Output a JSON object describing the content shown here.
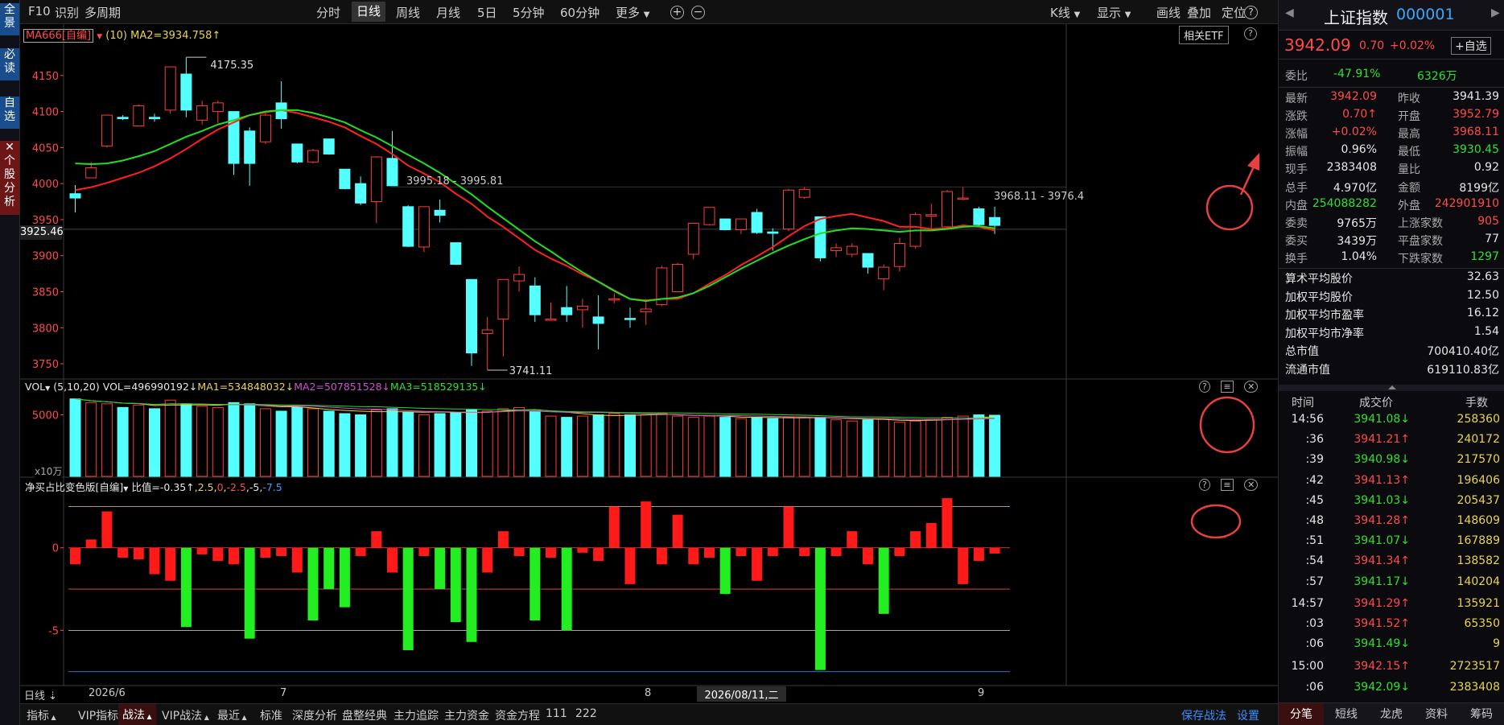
{
  "left_strip": [
    {
      "name": "quanjing",
      "label": "全\n景"
    },
    {
      "name": "bidu",
      "label": "必\n读"
    },
    {
      "name": "zixuan",
      "label": "自\n选"
    },
    {
      "name": "gegu-fenxi",
      "label": "✕\n个\n股\n分\n析"
    }
  ],
  "topbar": {
    "left": [
      "F10",
      "识别",
      "多周期"
    ],
    "periods": [
      "分时",
      "日线",
      "周线",
      "月线",
      "5日",
      "5分钟",
      "60分钟",
      "更多"
    ],
    "active_period": "日线",
    "right": [
      "K线",
      "显示",
      "画线",
      "叠加",
      "定位"
    ]
  },
  "main_chart": {
    "ma_label": "MA666[自编]",
    "ma_param": "(10)",
    "ma2": "MA2=3934.758↑",
    "etf_button": "相关ETF",
    "y_ticks": [
      "4150",
      "4100",
      "4050",
      "4000",
      "3950",
      "3900",
      "3850",
      "3800",
      "3750"
    ],
    "cursor_price": "3925.46",
    "high_label": "4175.35",
    "low_label": "3741.11",
    "range_label_1": "3995.18 - 3995.81",
    "range_label_2": "3968.11 - 3976.4"
  },
  "vol_panel": {
    "title": "VOL",
    "params": "(5,10,20)",
    "vol": "VOL=496990192↓",
    "ma1": "MA1=534848032↓",
    "ma2": "MA2=507851528↓",
    "ma3": "MA3=518529135↓",
    "y_tick": "5000",
    "unit": "x10万"
  },
  "ratio_panel": {
    "title": "净买占比变色版[自编]",
    "desc": "比值=-0.35↑",
    "values": [
      "2.5",
      "0",
      "-2.5",
      "-5",
      "-7.5"
    ],
    "y_ticks": [
      "0",
      "-5"
    ]
  },
  "date_axis": {
    "period": "日线",
    "labels": [
      "2026/6",
      "7",
      "8",
      "9"
    ],
    "cursor_date": "2026/08/11,二"
  },
  "bottombar": {
    "tabs": [
      "指标",
      "VIP指标",
      "战法",
      "VIP战法",
      "最近"
    ],
    "items": [
      "标准",
      "深度分析",
      "盘整经典",
      "主力追踪",
      "主力资金",
      "资金方程",
      "111",
      "222"
    ],
    "save": "保存战法",
    "settings": "设置"
  },
  "quote": {
    "name": "上证指数",
    "code": "000001",
    "price": "3942.09",
    "change": "0.70",
    "change_pct": "+0.02%",
    "add_watch": "+自选",
    "weibi_label": "委比",
    "weibi": "-47.91%",
    "weicha": "6326万",
    "rows": [
      {
        "l1": "最新",
        "v1": "3942.09",
        "c1": "red",
        "l2": "昨收",
        "v2": "3941.39",
        "c2": "white"
      },
      {
        "l1": "涨跌",
        "v1": "0.70↑",
        "c1": "red",
        "l2": "开盘",
        "v2": "3952.79",
        "c2": "red"
      },
      {
        "l1": "涨幅",
        "v1": "+0.02%",
        "c1": "red",
        "l2": "最高",
        "v2": "3968.11",
        "c2": "red"
      },
      {
        "l1": "振幅",
        "v1": "0.96%",
        "c1": "white",
        "l2": "最低",
        "v2": "3930.45",
        "c2": "green"
      },
      {
        "l1": "现手",
        "v1": "2383408",
        "c1": "white",
        "l2": "量比",
        "v2": "0.92",
        "c2": "white"
      },
      {
        "l1": "总手",
        "v1": "4.970亿",
        "c1": "white",
        "l2": "金额",
        "v2": "8199亿",
        "c2": "white"
      },
      {
        "l1": "内盘",
        "v1": "254088282",
        "c1": "green",
        "l2": "外盘",
        "v2": "242901910",
        "c2": "red"
      },
      {
        "l1": "委卖",
        "v1": "9765万",
        "c1": "white",
        "l2": "上涨家数",
        "v2": "905",
        "c2": "red"
      },
      {
        "l1": "委买",
        "v1": "3439万",
        "c1": "white",
        "l2": "平盘家数",
        "v2": "77",
        "c2": "white"
      },
      {
        "l1": "换手",
        "v1": "1.04%",
        "c1": "white",
        "l2": "下跌家数",
        "v2": "1297",
        "c2": "green"
      }
    ],
    "stats": [
      {
        "label": "算术平均股价",
        "value": "32.63"
      },
      {
        "label": "加权平均股价",
        "value": "12.50"
      },
      {
        "label": "加权平均市盈率",
        "value": "16.12"
      },
      {
        "label": "加权平均市净率",
        "value": "1.54"
      },
      {
        "label": "总市值",
        "value": "700410.40亿"
      },
      {
        "label": "流通市值",
        "value": "619110.83亿"
      }
    ]
  },
  "ticks_header": {
    "time": "时间",
    "price": "成交价",
    "vol": "手数"
  },
  "ticks": [
    {
      "time": "14:56",
      "price": "3941.08↓",
      "dir": "green",
      "vol": "258360"
    },
    {
      "time": ":36",
      "price": "3941.21↑",
      "dir": "red",
      "vol": "240172"
    },
    {
      "time": ":39",
      "price": "3940.98↓",
      "dir": "green",
      "vol": "217570"
    },
    {
      "time": ":42",
      "price": "3941.13↑",
      "dir": "red",
      "vol": "196406"
    },
    {
      "time": ":45",
      "price": "3941.03↓",
      "dir": "green",
      "vol": "205437"
    },
    {
      "time": ":48",
      "price": "3941.28↑",
      "dir": "red",
      "vol": "148609"
    },
    {
      "time": ":51",
      "price": "3941.07↓",
      "dir": "green",
      "vol": "167889"
    },
    {
      "time": ":54",
      "price": "3941.34↑",
      "dir": "red",
      "vol": "138582"
    },
    {
      "time": ":57",
      "price": "3941.17↓",
      "dir": "green",
      "vol": "140204"
    },
    {
      "time": "14:57",
      "price": "3941.29↑",
      "dir": "red",
      "vol": "135921"
    },
    {
      "time": ":03",
      "price": "3941.52↑",
      "dir": "red",
      "vol": "65350"
    },
    {
      "time": ":06",
      "price": "3941.49↓",
      "dir": "green",
      "vol": "9"
    },
    {
      "time": "15:00",
      "price": "3942.15↑",
      "dir": "red",
      "vol": "2723517"
    },
    {
      "time": ":06",
      "price": "3942.09↓",
      "dir": "green",
      "vol": "2383408"
    }
  ],
  "right_tabs": [
    "分笔",
    "短线",
    "龙虎",
    "资料",
    "筹码"
  ],
  "colors": {
    "up": "#ff3b3b",
    "down": "#54ffff",
    "ma_red": "#ff2020",
    "ma_green": "#22dd22",
    "annotation": "#e84040"
  },
  "chart_data": {
    "type": "candlestick",
    "candles": [
      {
        "o": 3986,
        "h": 3998,
        "l": 3960,
        "c": 3980
      },
      {
        "o": 4008,
        "h": 4030,
        "l": 4010,
        "c": 4022
      },
      {
        "o": 4052,
        "h": 4095,
        "l": 4050,
        "c": 4095
      },
      {
        "o": 4092,
        "h": 4095,
        "l": 4088,
        "c": 4090
      },
      {
        "o": 4080,
        "h": 4110,
        "l": 4080,
        "c": 4108
      },
      {
        "o": 4092,
        "h": 4097,
        "l": 4086,
        "c": 4090
      },
      {
        "o": 4102,
        "h": 4162,
        "l": 4097,
        "c": 4162
      },
      {
        "o": 4152,
        "h": 4175,
        "l": 4092,
        "c": 4102
      },
      {
        "o": 4088,
        "h": 4115,
        "l": 4082,
        "c": 4108
      },
      {
        "o": 4100,
        "h": 4115,
        "l": 4084,
        "c": 4112
      },
      {
        "o": 4100,
        "h": 4100,
        "l": 4012,
        "c": 4028
      },
      {
        "o": 4073,
        "h": 4078,
        "l": 3997,
        "c": 4028
      },
      {
        "o": 4058,
        "h": 4100,
        "l": 4055,
        "c": 4095
      },
      {
        "o": 4112,
        "h": 4142,
        "l": 4076,
        "c": 4090
      },
      {
        "o": 4055,
        "h": 4055,
        "l": 4028,
        "c": 4030
      },
      {
        "o": 4030,
        "h": 4048,
        "l": 4028,
        "c": 4046
      },
      {
        "o": 4062,
        "h": 4062,
        "l": 4040,
        "c": 4041
      },
      {
        "o": 4020,
        "h": 4020,
        "l": 3992,
        "c": 3993
      },
      {
        "o": 4000,
        "h": 4010,
        "l": 3970,
        "c": 3973
      },
      {
        "o": 3975,
        "h": 4038,
        "l": 3945,
        "c": 4037
      },
      {
        "o": 4035,
        "h": 4073,
        "l": 3997,
        "c": 3997
      },
      {
        "o": 3968,
        "h": 3970,
        "l": 3912,
        "c": 3913
      },
      {
        "o": 3912,
        "h": 3968,
        "l": 3905,
        "c": 3968
      },
      {
        "o": 3963,
        "h": 3978,
        "l": 3946,
        "c": 3956
      },
      {
        "o": 3918,
        "h": 3918,
        "l": 3887,
        "c": 3888
      },
      {
        "o": 3867,
        "h": 3867,
        "l": 3747,
        "c": 3765
      },
      {
        "o": 3792,
        "h": 3815,
        "l": 3741,
        "c": 3797
      },
      {
        "o": 3812,
        "h": 3867,
        "l": 3760,
        "c": 3867
      },
      {
        "o": 3865,
        "h": 3885,
        "l": 3850,
        "c": 3874
      },
      {
        "o": 3858,
        "h": 3870,
        "l": 3808,
        "c": 3818
      },
      {
        "o": 3812,
        "h": 3835,
        "l": 3812,
        "c": 3812
      },
      {
        "o": 3828,
        "h": 3858,
        "l": 3808,
        "c": 3818
      },
      {
        "o": 3825,
        "h": 3840,
        "l": 3800,
        "c": 3830
      },
      {
        "o": 3815,
        "h": 3845,
        "l": 3770,
        "c": 3806
      },
      {
        "o": 3840,
        "h": 3848,
        "l": 3834,
        "c": 3840
      },
      {
        "o": 3813,
        "h": 3828,
        "l": 3800,
        "c": 3812
      },
      {
        "o": 3822,
        "h": 3840,
        "l": 3804,
        "c": 3826
      },
      {
        "o": 3832,
        "h": 3886,
        "l": 3830,
        "c": 3883
      },
      {
        "o": 3850,
        "h": 3890,
        "l": 3850,
        "c": 3888
      },
      {
        "o": 3902,
        "h": 3945,
        "l": 3895,
        "c": 3945
      },
      {
        "o": 3943,
        "h": 3967,
        "l": 3942,
        "c": 3967
      },
      {
        "o": 3951,
        "h": 3951,
        "l": 3935,
        "c": 3936
      },
      {
        "o": 3936,
        "h": 3951,
        "l": 3930,
        "c": 3951
      },
      {
        "o": 3960,
        "h": 3965,
        "l": 3930,
        "c": 3932
      },
      {
        "o": 3933,
        "h": 3938,
        "l": 3907,
        "c": 3931
      },
      {
        "o": 3937,
        "h": 3993,
        "l": 3934,
        "c": 3991
      },
      {
        "o": 3981,
        "h": 3995,
        "l": 3979,
        "c": 3992
      },
      {
        "o": 3954,
        "h": 3954,
        "l": 3892,
        "c": 3897
      },
      {
        "o": 3907,
        "h": 3917,
        "l": 3898,
        "c": 3911
      },
      {
        "o": 3902,
        "h": 3917,
        "l": 3898,
        "c": 3913
      },
      {
        "o": 3903,
        "h": 3903,
        "l": 3875,
        "c": 3884
      },
      {
        "o": 3868,
        "h": 3888,
        "l": 3852,
        "c": 3884
      },
      {
        "o": 3885,
        "h": 3925,
        "l": 3878,
        "c": 3917
      },
      {
        "o": 3913,
        "h": 3960,
        "l": 3910,
        "c": 3957
      },
      {
        "o": 3955,
        "h": 3972,
        "l": 3935,
        "c": 3957
      },
      {
        "o": 3940,
        "h": 3991,
        "l": 3938,
        "c": 3989
      },
      {
        "o": 3980,
        "h": 3995,
        "l": 3977,
        "c": 3980
      },
      {
        "o": 3965,
        "h": 3968,
        "l": 3942,
        "c": 3943
      },
      {
        "o": 3953,
        "h": 3968,
        "l": 3930,
        "c": 3942
      }
    ],
    "ma_red": [
      3991,
      3995,
      4001,
      4008,
      4015,
      4024,
      4035,
      4048,
      4062,
      4075,
      4085,
      4095,
      4099,
      4102,
      4098,
      4092,
      4086,
      4078,
      4066,
      4055,
      4041,
      4025,
      4014,
      4002,
      3986,
      3972,
      3954,
      3940,
      3924,
      3908,
      3896,
      3886,
      3874,
      3864,
      3852,
      3840,
      3838,
      3840,
      3840,
      3848,
      3861,
      3873,
      3887,
      3899,
      3912,
      3927,
      3941,
      3951,
      3955,
      3958,
      3953,
      3948,
      3940,
      3940,
      3937,
      3938,
      3942,
      3940,
      3935
    ],
    "ma_green": [
      4028,
      4027,
      4028,
      4032,
      4038,
      4045,
      4055,
      4065,
      4073,
      4082,
      4088,
      4095,
      4100,
      4102,
      4102,
      4098,
      4092,
      4085,
      4074,
      4064,
      4052,
      4040,
      4028,
      4015,
      4000,
      3985,
      3968,
      3952,
      3936,
      3920,
      3906,
      3891,
      3877,
      3864,
      3851,
      3840,
      3837,
      3840,
      3842,
      3848,
      3858,
      3870,
      3882,
      3893,
      3904,
      3914,
      3923,
      3931,
      3935,
      3938,
      3937,
      3935,
      3933,
      3935,
      3935,
      3937,
      3940,
      3941,
      3938
    ],
    "volume": [
      6300,
      6000,
      5900,
      5600,
      5800,
      5500,
      6200,
      5900,
      5700,
      5600,
      6000,
      5900,
      5500,
      5300,
      5600,
      5500,
      5300,
      5100,
      5000,
      5400,
      5500,
      5200,
      5000,
      5100,
      5200,
      5400,
      5300,
      5500,
      5600,
      5300,
      4900,
      4800,
      4900,
      5000,
      5100,
      5000,
      5000,
      5100,
      4900,
      4800,
      4900,
      4800,
      4700,
      4800,
      4700,
      4800,
      4800,
      4800,
      4600,
      4500,
      4600,
      4700,
      4400,
      4500,
      4600,
      4800,
      4900,
      5000,
      4969
    ],
    "ratio": [
      -1.0,
      0.5,
      2.2,
      -0.6,
      -0.7,
      -1.6,
      -2.0,
      -4.8,
      -0.4,
      -0.8,
      -1.0,
      -5.5,
      -0.6,
      -0.5,
      -1.5,
      -4.4,
      -2.5,
      -3.6,
      -0.5,
      1.0,
      -1.5,
      -6.2,
      -0.5,
      -2.5,
      -4.5,
      -5.7,
      -1.5,
      1.0,
      -0.5,
      -4.4,
      -0.6,
      -5.0,
      -0.3,
      -0.8,
      2.5,
      -2.2,
      2.8,
      -1.0,
      2.0,
      -1.0,
      -0.6,
      -2.8,
      -0.5,
      -2.0,
      -0.5,
      2.5,
      -0.5,
      -7.4,
      -0.5,
      1.0,
      -1.0,
      -4.0,
      -0.5,
      1.0,
      1.5,
      3.0,
      -2.2,
      -0.8,
      -0.35
    ],
    "ylim": [
      3730,
      4190
    ]
  }
}
